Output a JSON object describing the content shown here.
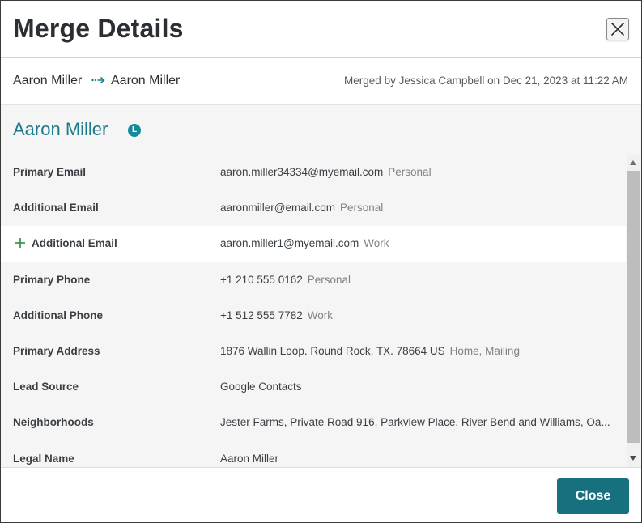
{
  "dialog": {
    "title": "Merge Details",
    "close_label": "Close"
  },
  "merge": {
    "from_name": "Aaron Miller",
    "to_name": "Aaron Miller",
    "merged_by": "Merged by Jessica Campbell on Dec 21, 2023 at 11:22 AM"
  },
  "contact": {
    "name": "Aaron Miller",
    "badge": "L"
  },
  "fields": [
    {
      "label": "Primary Email",
      "value": "aaron.miller34334@myemail.com",
      "tag": "Personal",
      "added": false
    },
    {
      "label": "Additional Email",
      "value": "aaronmiller@email.com",
      "tag": "Personal",
      "added": false
    },
    {
      "label": "Additional Email",
      "value": "aaron.miller1@myemail.com",
      "tag": "Work",
      "added": true
    },
    {
      "label": "Primary Phone",
      "value": "+1 210 555 0162",
      "tag": "Personal",
      "added": false
    },
    {
      "label": "Additional Phone",
      "value": "+1 512 555 7782",
      "tag": "Work",
      "added": false
    },
    {
      "label": "Primary Address",
      "value": "1876 Wallin Loop. Round Rock, TX. 78664 US",
      "tag": "Home, Mailing",
      "added": false
    },
    {
      "label": "Lead Source",
      "value": "Google Contacts",
      "tag": "",
      "added": false
    },
    {
      "label": "Neighborhoods",
      "value": "Jester Farms, Private Road 916, Parkview Place, River Bend and Williams, Oa...",
      "tag": "",
      "added": false
    },
    {
      "label": "Legal Name",
      "value": "Aaron Miller",
      "tag": "",
      "added": false
    }
  ],
  "colors": {
    "accent": "#16707d",
    "name_teal": "#1a7a8a",
    "added_green": "#2e8b3e"
  },
  "icons": {
    "close": "close-icon",
    "merge_arrow": "merge-arrow-icon",
    "plus": "plus-icon"
  }
}
